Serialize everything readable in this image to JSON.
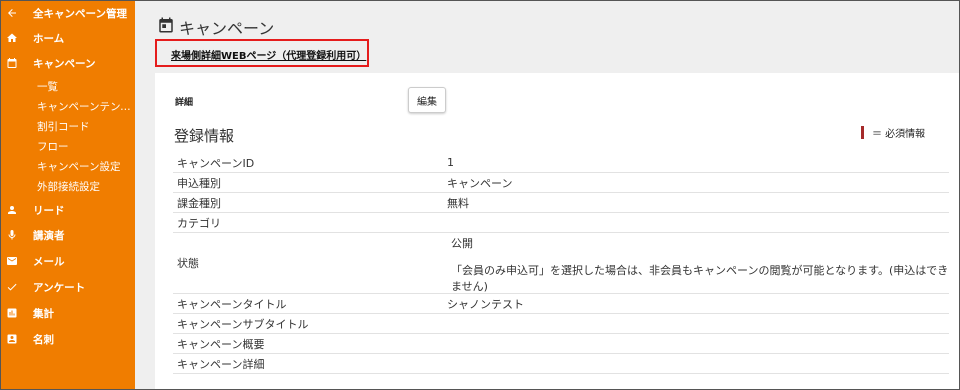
{
  "sidebar": {
    "items": [
      {
        "label": "全キャンペーン管理",
        "icon": "arrow-left-icon"
      },
      {
        "label": "ホーム",
        "icon": "home-icon"
      },
      {
        "label": "キャンペーン",
        "icon": "calendar-icon"
      },
      {
        "label": "リード",
        "icon": "person-icon"
      },
      {
        "label": "講演者",
        "icon": "mic-icon"
      },
      {
        "label": "メール",
        "icon": "mail-icon"
      },
      {
        "label": "アンケート",
        "icon": "check-icon"
      },
      {
        "label": "集計",
        "icon": "chart-icon"
      },
      {
        "label": "名刺",
        "icon": "card-icon"
      }
    ],
    "subitems": [
      "一覧",
      "キャンペーンテンプレート",
      "割引コード",
      "フロー",
      "キャンペーン設定",
      "外部接続設定"
    ]
  },
  "header": {
    "title": "キャンペーン",
    "icon": "calendar-icon"
  },
  "link": {
    "text": "来場側詳細WEBページ（代理登録利用可）"
  },
  "detail": {
    "label": "詳細",
    "edit_label": "編集",
    "section_title": "登録情報",
    "required_legend": "＝ 必須情報"
  },
  "rows": [
    {
      "key": "キャンペーンID",
      "value": "1"
    },
    {
      "key": "申込種別",
      "value": "キャンペーン"
    },
    {
      "key": "課金種別",
      "value": "無料"
    },
    {
      "key": "カテゴリ",
      "value": ""
    },
    {
      "key": "状態",
      "value": "公開",
      "note": "「会員のみ申込可」を選択した場合は、非会員もキャンペーンの閲覧が可能となります。(申込はできません)"
    },
    {
      "key": "キャンペーンタイトル",
      "value": "シャノンテスト"
    },
    {
      "key": "キャンペーンサブタイトル",
      "value": ""
    },
    {
      "key": "キャンペーン概要",
      "value": ""
    },
    {
      "key": "キャンペーン詳細",
      "value": ""
    }
  ],
  "colors": {
    "sidebar": "#f07d00",
    "highlight_border": "#e51c1c",
    "required_marker": "#a52a2a"
  }
}
